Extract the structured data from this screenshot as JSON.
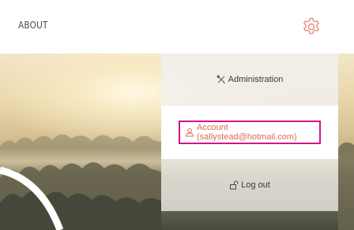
{
  "header": {
    "nav_about": "ABOUT",
    "settings_icon": "gear-icon"
  },
  "menu": {
    "items": [
      {
        "label": "Administration",
        "icon": "tools-icon"
      },
      {
        "label": "Account (sallystead@hotmail.com)",
        "icon": "user-icon",
        "highlighted": true
      },
      {
        "label": "Log out",
        "icon": "unlock-icon"
      }
    ]
  },
  "colors": {
    "accent": "#e06a54",
    "highlight_border": "#d4148e",
    "text": "#3a3a3a"
  }
}
